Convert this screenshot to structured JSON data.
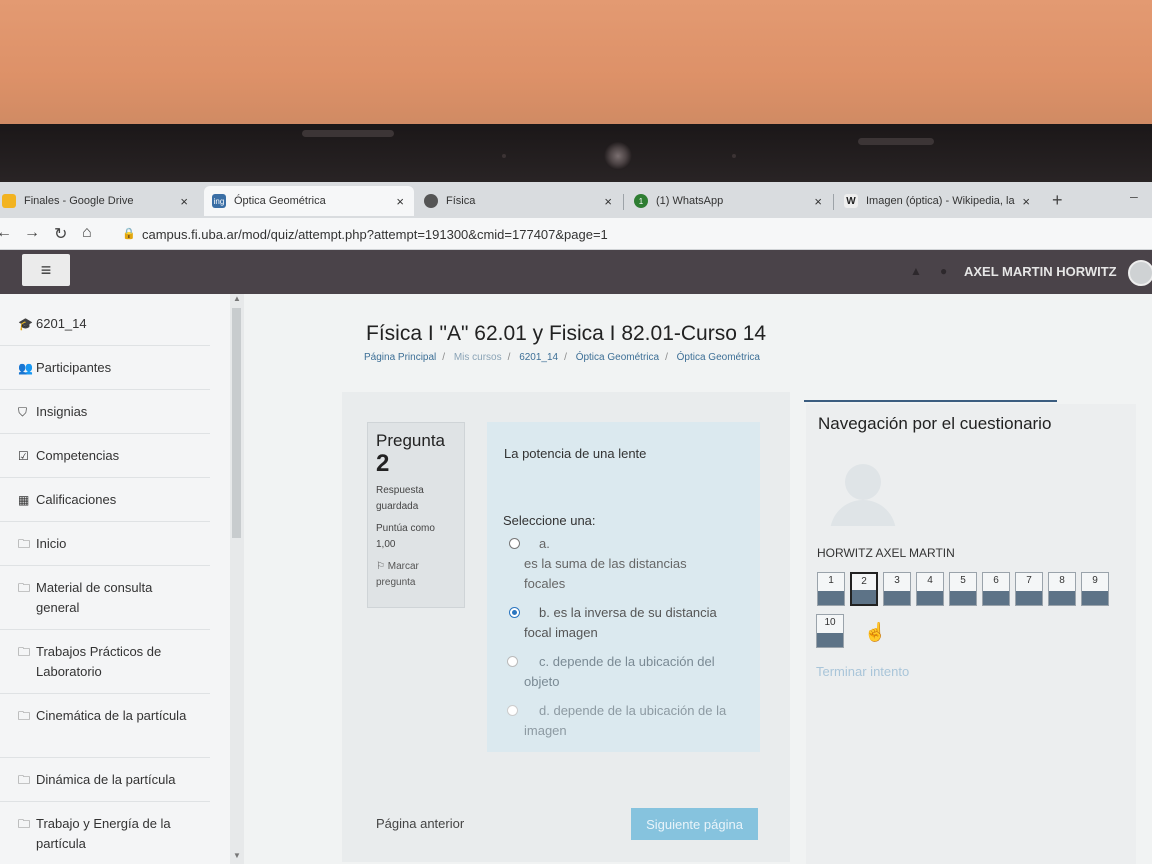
{
  "browser": {
    "tabs": [
      {
        "title": "Finales - Google Drive",
        "active": false
      },
      {
        "title": "Óptica Geométrica",
        "active": true
      },
      {
        "title": "Física",
        "active": false
      },
      {
        "title": "(1) WhatsApp",
        "active": false
      },
      {
        "title": "Imagen (óptica) - Wikipedia, la",
        "active": false
      }
    ],
    "url": "campus.fi.uba.ar/mod/quiz/attempt.php?attempt=191300&cmid=177407&page=1",
    "close_glyph": "×",
    "new_tab_glyph": "+"
  },
  "navbar": {
    "menu_glyph": "≡",
    "user_name": "AXEL MARTIN HORWITZ"
  },
  "sidebar": {
    "items": [
      {
        "label": "6201_14",
        "icon": "graduation-cap-icon"
      },
      {
        "label": "Participantes",
        "icon": "users-icon"
      },
      {
        "label": "Insignias",
        "icon": "shield-icon"
      },
      {
        "label": "Competencias",
        "icon": "checkbox-icon"
      },
      {
        "label": "Calificaciones",
        "icon": "table-icon"
      },
      {
        "label": "Inicio",
        "icon": "folder-icon"
      },
      {
        "label": "Material de consulta general",
        "icon": "folder-icon"
      },
      {
        "label": "Trabajos Prácticos de Laboratorio",
        "icon": "folder-icon"
      },
      {
        "label": "Cinemática de la partícula",
        "icon": "folder-icon"
      },
      {
        "label": "Dinámica de la partícula",
        "icon": "folder-icon"
      },
      {
        "label": "Trabajo y Energía de la partícula",
        "icon": "folder-icon"
      }
    ]
  },
  "main": {
    "course_title": "Física I \"A\" 62.01 y Fisica I 82.01-Curso 14",
    "breadcrumb": [
      "Página Principal",
      "Mis cursos",
      "6201_14",
      "Óptica Geométrica",
      "Óptica Geométrica"
    ],
    "breadcrumb_sep": "/"
  },
  "question": {
    "label": "Pregunta",
    "number": "2",
    "status": "Respuesta guardada",
    "points": "Puntúa como 1,00",
    "flag": "Marcar pregunta",
    "text": "La potencia de una lente",
    "prompt": "Seleccione una:",
    "options": [
      {
        "letter": "a.",
        "text": "es la suma de las distancias focales",
        "selected": false
      },
      {
        "letter": "b.",
        "text": "es la inversa de su distancia focal imagen",
        "selected": true
      },
      {
        "letter": "c.",
        "text": "depende de la ubicación del objeto",
        "selected": false
      },
      {
        "letter": "d.",
        "text": "depende de la ubicación de la imagen",
        "selected": false
      }
    ],
    "prev_label": "Página anterior",
    "next_label": "Siguiente página"
  },
  "quiz_nav": {
    "title": "Navegación por el cuestionario",
    "student_name": "HORWITZ AXEL MARTIN",
    "buttons": [
      "1",
      "2",
      "3",
      "4",
      "5",
      "6",
      "7",
      "8",
      "9",
      "10"
    ],
    "current": "2",
    "finish_label": "Terminar intento"
  },
  "colors": {
    "navbar": "#4a4349",
    "link": "#3d6f96",
    "answered_fill": "#5d7387",
    "next_button": "#86c3de"
  }
}
